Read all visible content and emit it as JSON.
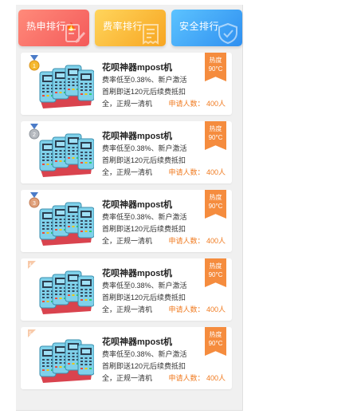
{
  "tabs": [
    {
      "label": "热申排行",
      "icon": "flame-icon",
      "deco": "document-pen-icon"
    },
    {
      "label": "费率排行",
      "icon": null,
      "deco": "receipt-icon"
    },
    {
      "label": "安全排行",
      "icon": null,
      "deco": "shield-icon"
    }
  ],
  "colors": {
    "hot": "#f45a5a",
    "rate": "#f7a521",
    "safe": "#2f8ff0",
    "heat_badge": "#f58c3e",
    "applicants": "#f07a1f"
  },
  "products": [
    {
      "rank": "1",
      "medal": "gold",
      "title": "花呗神器mpost机",
      "desc": "费率低至0.38%、新户激活首刷即送120元后续费抵扣全，正规一清机",
      "heat_label": "热度",
      "heat_value": "90°C",
      "applicants": "申请人数：  400人"
    },
    {
      "rank": "2",
      "medal": "silver",
      "title": "花呗神器mpost机",
      "desc": "费率低至0.38%、新户激活首刷即送120元后续费抵扣全，正规一清机",
      "heat_label": "热度",
      "heat_value": "90°C",
      "applicants": "申请人数：  400人"
    },
    {
      "rank": "3",
      "medal": "bronze",
      "title": "花呗神器mpost机",
      "desc": "费率低至0.38%、新户激活首刷即送120元后续费抵扣全，正规一清机",
      "heat_label": "热度",
      "heat_value": "90°C",
      "applicants": "申请人数：  400人"
    },
    {
      "rank": "4",
      "medal": "plain",
      "title": "花呗神器mpost机",
      "desc": "费率低至0.38%、新户激活首刷即送120元后续费抵扣全，正规一清机",
      "heat_label": "热度",
      "heat_value": "90°C",
      "applicants": "申请人数：  400人"
    },
    {
      "rank": "5",
      "medal": "plain",
      "title": "花呗神器mpost机",
      "desc": "费率低至0.38%、新户激活首刷即送120元后续费抵扣全，正规一清机",
      "heat_label": "热度",
      "heat_value": "90°C",
      "applicants": "申请人数：  400人"
    }
  ]
}
